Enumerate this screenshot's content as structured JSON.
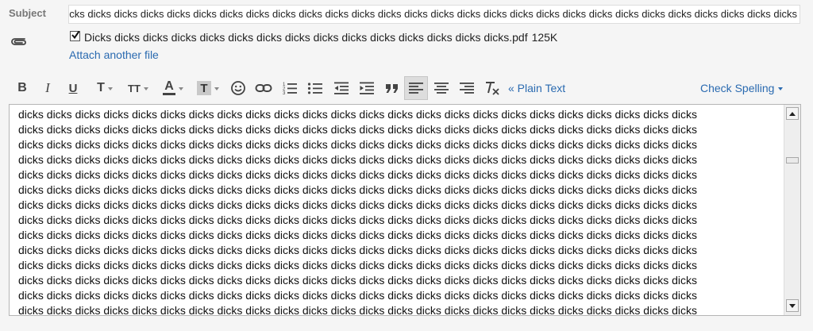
{
  "subject": {
    "label": "Subject",
    "value": "Dicks dicks dicks dicks dicks dicks dicks dicks dicks dicks dicks dicks dicks dicks dicks dicks dicks dicks dicks dicks dicks dicks dicks dicks dicks dicks dicks dicks dicks dicks dicks dicks dicks dicks dicks dicks dicks dicks"
  },
  "attachment": {
    "checked": true,
    "filename": "Dicks dicks dicks dicks dicks dicks dicks dicks dicks dicks dicks dicks dicks dicks dicks.pdf",
    "size": "125K",
    "attach_another": "Attach another file"
  },
  "toolbar": {
    "buttons": [
      {
        "name": "bold-button",
        "icon": "bold-icon",
        "glyph": "B"
      },
      {
        "name": "italic-button",
        "icon": "italic-icon",
        "glyph": "I"
      },
      {
        "name": "underline-button",
        "icon": "underline-icon",
        "glyph": "U"
      },
      {
        "name": "font-button",
        "icon": "font-icon",
        "glyph": "T"
      },
      {
        "name": "font-size-button",
        "icon": "font-size-icon",
        "glyph": "TT"
      },
      {
        "name": "text-color-button",
        "icon": "text-color-icon",
        "glyph": "A"
      },
      {
        "name": "highlight-button",
        "icon": "highlight-icon",
        "glyph": "T"
      },
      {
        "name": "emoji-button",
        "icon": "smiley-icon"
      },
      {
        "name": "link-button",
        "icon": "link-icon"
      },
      {
        "name": "numbered-list-button",
        "icon": "numbered-list-icon"
      },
      {
        "name": "bulleted-list-button",
        "icon": "bulleted-list-icon"
      },
      {
        "name": "indent-less-button",
        "icon": "indent-less-icon"
      },
      {
        "name": "indent-more-button",
        "icon": "indent-more-icon"
      },
      {
        "name": "quote-button",
        "icon": "quote-icon"
      },
      {
        "name": "align-left-button",
        "icon": "align-left-icon",
        "active": true
      },
      {
        "name": "align-center-button",
        "icon": "align-center-icon"
      },
      {
        "name": "align-right-button",
        "icon": "align-right-icon"
      },
      {
        "name": "remove-formatting-button",
        "icon": "remove-formatting-icon"
      }
    ],
    "plain_text_label": "« Plain Text",
    "check_spelling_label": "Check Spelling"
  },
  "editor": {
    "body_lines": [
      "dicks dicks dicks dicks dicks dicks dicks dicks dicks dicks dicks dicks dicks dicks dicks dicks dicks dicks dicks dicks dicks dicks dicks dicks",
      "dicks dicks dicks dicks dicks dicks dicks dicks dicks dicks dicks dicks dicks dicks dicks dicks dicks dicks dicks dicks dicks dicks dicks dicks",
      "dicks dicks dicks dicks dicks dicks dicks dicks dicks dicks dicks dicks dicks dicks dicks dicks dicks dicks dicks dicks dicks dicks dicks dicks",
      "dicks dicks dicks dicks dicks dicks dicks dicks dicks dicks dicks dicks dicks dicks dicks dicks dicks dicks dicks dicks dicks dicks dicks dicks",
      "dicks dicks dicks dicks dicks dicks dicks dicks dicks dicks dicks dicks dicks dicks dicks dicks dicks dicks dicks dicks dicks dicks dicks dicks",
      "dicks dicks dicks dicks dicks dicks dicks dicks dicks dicks dicks dicks dicks dicks dicks dicks dicks dicks dicks dicks dicks dicks dicks dicks",
      "dicks dicks dicks dicks dicks dicks dicks dicks dicks dicks dicks dicks dicks dicks dicks dicks dicks dicks dicks dicks dicks dicks dicks dicks",
      "dicks dicks dicks dicks dicks dicks dicks dicks dicks dicks dicks dicks dicks dicks dicks dicks dicks dicks dicks dicks dicks dicks dicks dicks",
      "dicks dicks dicks dicks dicks dicks dicks dicks dicks dicks dicks dicks dicks dicks dicks dicks dicks dicks dicks dicks dicks dicks dicks dicks",
      "dicks dicks dicks dicks dicks dicks dicks dicks dicks dicks dicks dicks dicks dicks dicks dicks dicks dicks dicks dicks dicks dicks dicks dicks",
      "dicks dicks dicks dicks dicks dicks dicks dicks dicks dicks dicks dicks dicks dicks dicks dicks dicks dicks dicks dicks dicks dicks dicks dicks",
      "dicks dicks dicks dicks dicks dicks dicks dicks dicks dicks dicks dicks dicks dicks dicks dicks dicks dicks dicks dicks dicks dicks dicks dicks",
      "dicks dicks dicks dicks dicks dicks dicks dicks dicks dicks dicks dicks dicks dicks dicks dicks dicks dicks dicks dicks dicks dicks dicks dicks",
      "dicks dicks dicks dicks dicks dicks dicks dicks dicks dicks dicks dicks dicks dicks dicks dicks dicks dicks dicks dicks dicks dicks dicks dicks"
    ]
  },
  "colors": {
    "link": "#2a6ab0",
    "label": "#777777",
    "background": "#f5f5f5"
  }
}
